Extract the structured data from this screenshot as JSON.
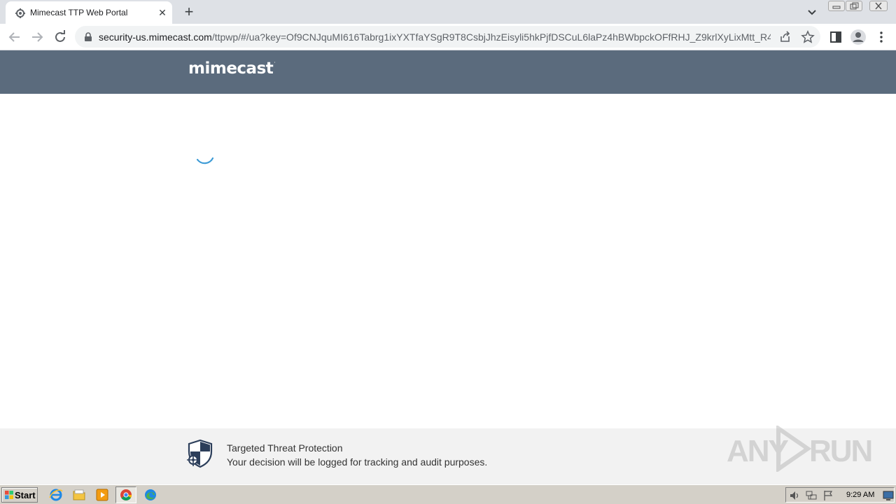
{
  "browser": {
    "tab_title": "Mimecast TTP Web Portal",
    "new_tab_label": "+",
    "url_host": "security-us.mimecast.com",
    "url_path": "/ttpwp/#/ua?key=Of9CNJquMI616Tabrg1ixYXTfaYSgR9T8CsbjJhzEisyli5hkPjfDSCuL6laPz4hBWbpckOFfRHJ_Z9krlXyLixMtt_R46..."
  },
  "page": {
    "brand": "mimecast",
    "brand_mark": "·",
    "loading": true,
    "footer": {
      "title": "Targeted Threat Protection",
      "text": "Your decision will be logged for tracking and audit purposes."
    }
  },
  "watermark": {
    "left": "ANY",
    "right": "RUN"
  },
  "taskbar": {
    "start_label": "Start",
    "apps": [
      "internet-explorer-icon",
      "file-explorer-icon",
      "media-player-icon",
      "chrome-icon",
      "edge-icon"
    ],
    "clock": "9:29 AM"
  },
  "colors": {
    "header_bg": "#5b6b7d",
    "footer_bg": "#f2f2f2",
    "spinner": "#3d9bd6",
    "shield": "#2c3e5a"
  }
}
